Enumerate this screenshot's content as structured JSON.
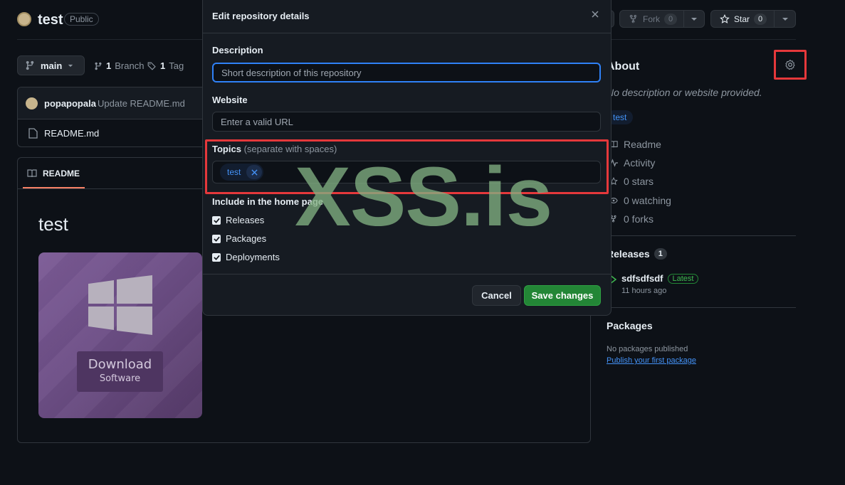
{
  "repo": {
    "name": "test",
    "visibility": "Public"
  },
  "actions": {
    "fork_label": "Fork",
    "fork_count": "0",
    "star_label": "Star",
    "star_count": "0"
  },
  "branch": {
    "current": "main",
    "branch_count": "1",
    "branch_word": "Branch",
    "tag_count": "1",
    "tag_word": "Tag"
  },
  "commit": {
    "user": "popapopala",
    "message": "Update README.md"
  },
  "files": [
    {
      "name": "README.md"
    }
  ],
  "readme": {
    "tab_label": "README",
    "heading": "test",
    "image": {
      "line1": "Download",
      "line2": "Software"
    }
  },
  "about": {
    "title": "About",
    "description": "No description or website provided.",
    "topic": "test",
    "items": [
      {
        "icon": "book-icon",
        "label": "Readme"
      },
      {
        "icon": "pulse-icon",
        "label": "Activity"
      },
      {
        "icon": "star-icon",
        "label": "0 stars"
      },
      {
        "icon": "eye-icon",
        "label": "0 watching"
      },
      {
        "icon": "fork-icon",
        "label": "0 forks"
      }
    ]
  },
  "releases": {
    "title": "Releases",
    "count": "1",
    "name": "sdfsdfsdf",
    "badge": "Latest",
    "time": "11 hours ago"
  },
  "packages": {
    "title": "Packages",
    "none_text": "No packages published",
    "link_text": "Publish your first package"
  },
  "modal": {
    "title": "Edit repository details",
    "description_label": "Description",
    "description_placeholder": "Short description of this repository",
    "website_label": "Website",
    "website_placeholder": "Enter a valid URL",
    "topics_label": "Topics",
    "topics_hint": "(separate with spaces)",
    "topic_tokens": [
      "test"
    ],
    "home_label": "Include in the home page",
    "checkboxes": [
      {
        "label": "Releases",
        "checked": true
      },
      {
        "label": "Packages",
        "checked": true
      },
      {
        "label": "Deployments",
        "checked": true
      }
    ],
    "cancel_label": "Cancel",
    "save_label": "Save changes"
  },
  "watermark": "XSS.is",
  "colors": {
    "highlight": "#e5383b",
    "accent": "#2f81f7",
    "save": "#238636"
  }
}
